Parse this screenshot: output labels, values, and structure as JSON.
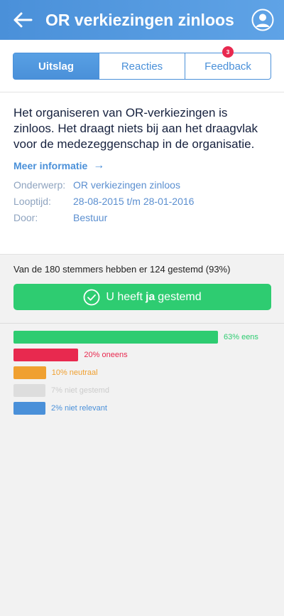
{
  "header": {
    "title": "OR verkiezingen zinloos",
    "colors": {
      "bar_start": "#4a90d9",
      "bar_end": "#5fa3e6"
    }
  },
  "tabs": [
    {
      "label": "Uitslag",
      "active": true
    },
    {
      "label": "Reacties",
      "active": false
    },
    {
      "label": "Feedback",
      "active": false,
      "badge": "3"
    }
  ],
  "statement": "Het organiseren van OR-verkiezingen is zinloos. Het draagt niets bij aan het draagvlak voor de medezeggenschap in de organisatie.",
  "more_info": {
    "label": "Meer informatie",
    "arrow": "→"
  },
  "meta": [
    {
      "key": "Onderwerp:",
      "value": "OR verkiezingen zinloos"
    },
    {
      "key": "Looptijd:",
      "value": "28-08-2015 t/m 28-01-2016"
    },
    {
      "key": "Door:",
      "value": "Bestuur"
    }
  ],
  "results": {
    "summary": "Van de 180 stemmers hebben er 124 gestemd (93%)",
    "vote_button": {
      "prefix": "U heeft",
      "emphasis": "ja",
      "suffix": "gestemd",
      "color": "#2ecc71"
    },
    "bars": [
      {
        "label": "63% eens",
        "percent": 63,
        "color": "#2ecc71",
        "label_color": "#2ecc71"
      },
      {
        "label": "20% oneens",
        "percent": 20,
        "color": "#e8294f",
        "label_color": "#e8294f"
      },
      {
        "label": "10% neutraal",
        "percent": 10,
        "color": "#f0a030",
        "label_color": "#f0a030"
      },
      {
        "label": "7% niet gestemd",
        "percent": 7,
        "color": "#dddddd",
        "label_color": "#cccccc"
      },
      {
        "label": "2% niet relevant",
        "percent": 2,
        "color": "#4a90d9",
        "label_color": "#4a90d9"
      }
    ]
  },
  "icons": {
    "back": "arrow-left-icon",
    "avatar": "user-circle-icon",
    "check": "check-circle-icon"
  }
}
